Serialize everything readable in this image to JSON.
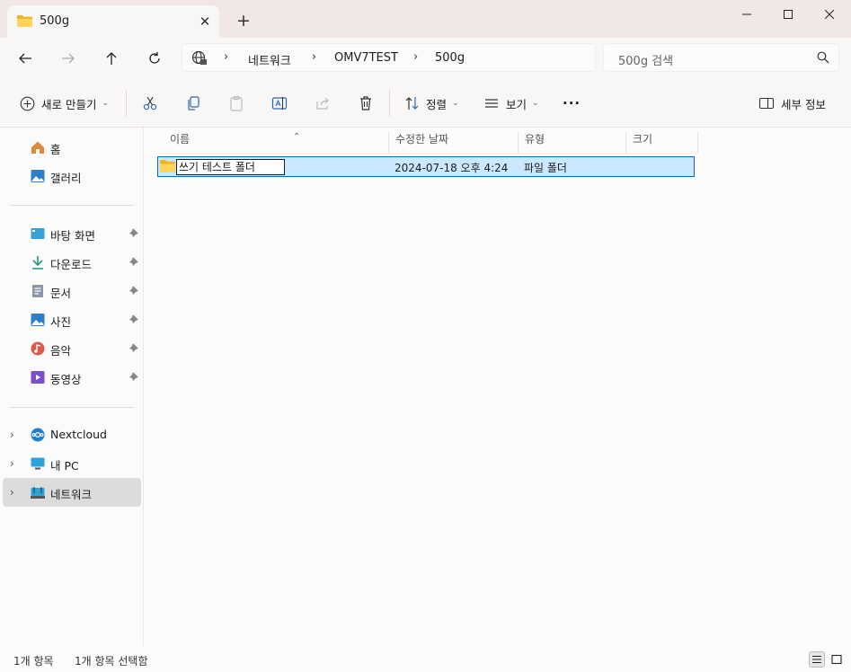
{
  "window": {
    "tab_title": "500g",
    "tab_close_glyph": "✕",
    "new_tab_glyph": "+"
  },
  "address": {
    "crumbs": [
      "네트워크",
      "OMV7TEST",
      "500g"
    ],
    "search_placeholder": "500g 검색"
  },
  "toolbar": {
    "new_label": "새로 만들기",
    "sort_label": "정렬",
    "view_label": "보기",
    "more_glyph": "···",
    "details_label": "세부 정보"
  },
  "sidebar": {
    "quick": [
      {
        "label": "홈",
        "icon": "home-icon"
      },
      {
        "label": "갤러리",
        "icon": "gallery-icon"
      }
    ],
    "pinned": [
      {
        "label": "바탕 화면",
        "icon": "desktop-icon"
      },
      {
        "label": "다운로드",
        "icon": "download-icon"
      },
      {
        "label": "문서",
        "icon": "documents-icon"
      },
      {
        "label": "사진",
        "icon": "pictures-icon"
      },
      {
        "label": "음악",
        "icon": "music-icon"
      },
      {
        "label": "동영상",
        "icon": "videos-icon"
      }
    ],
    "locations": [
      {
        "label": "Nextcloud",
        "icon": "nextcloud-icon"
      },
      {
        "label": "내 PC",
        "icon": "pc-icon"
      },
      {
        "label": "네트워크",
        "icon": "network-icon",
        "selected": true
      }
    ]
  },
  "columns": {
    "name": "이름",
    "modified": "수정한 날짜",
    "type": "유형",
    "size": "크기"
  },
  "files": [
    {
      "name": "쓰기 테스트 폴더",
      "modified": "2024-07-18 오후 4:24",
      "type": "파일 폴더",
      "size": ""
    }
  ],
  "status": {
    "count": "1개 항목",
    "selected": "1개 항목 선택함"
  },
  "colors": {
    "accent": "#0a67c4",
    "selection": "#cce8ff",
    "folder": "#f5c542"
  }
}
